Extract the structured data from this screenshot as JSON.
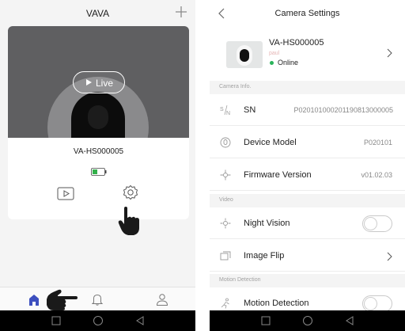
{
  "left": {
    "header": {
      "title": "VAVA",
      "add_icon": "plus-icon"
    },
    "device_card": {
      "live_label": "Live",
      "device_name": "VA-HS000005",
      "battery_icon": "battery-icon",
      "play_icon": "playback-icon",
      "settings_icon": "gear-icon"
    },
    "tabs": [
      {
        "name": "home",
        "icon": "home-icon",
        "active": true
      },
      {
        "name": "notifications",
        "icon": "bell-icon",
        "active": false
      },
      {
        "name": "profile",
        "icon": "user-icon",
        "active": false
      }
    ]
  },
  "right": {
    "header": {
      "title": "Camera Settings"
    },
    "device": {
      "name": "VA-HS000005",
      "subtitle": "paul",
      "status": "Online"
    },
    "sections": {
      "camera_info": "Camera Info.",
      "video": "Video",
      "motion": "Motion Detection"
    },
    "rows": {
      "sn": {
        "label": "SN",
        "value": "P020101000201190813000005"
      },
      "model": {
        "label": "Device Model",
        "value": "P020101"
      },
      "firmware": {
        "label": "Firmware Version",
        "value": "v01.02.03"
      },
      "night_vision": {
        "label": "Night Vision",
        "enabled": false
      },
      "image_flip": {
        "label": "Image Flip"
      },
      "motion_detection": {
        "label": "Motion Detection",
        "enabled": false
      }
    }
  },
  "colors": {
    "accent": "#3d4fbf",
    "online": "#2ab35a",
    "battery": "#33b04a",
    "navbar": "#000000"
  }
}
